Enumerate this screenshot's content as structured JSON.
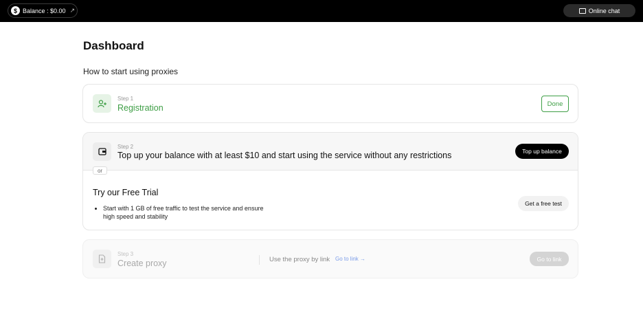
{
  "topbar": {
    "balance_label": "Balance : $0.00",
    "balance_icon": "$",
    "balance_arrow": "↗",
    "chat_label": "Online chat",
    "chat_icon": "message-square-icon"
  },
  "page": {
    "title": "Dashboard",
    "subtitle": "How to start using proxies"
  },
  "steps": [
    {
      "step_label": "Step 1",
      "title": "Registration",
      "icon": "user-add-icon",
      "button": "Done",
      "status_color": "#3e9e45"
    },
    {
      "step_label": "Step 2",
      "title": "Top up your balance with at least $10 and start using the service without any restrictions",
      "icon": "wallet-icon",
      "button": "Top up balance",
      "or_label": "or",
      "trial": {
        "title": "Try our Free Trial",
        "bullets": [
          "Start with 1 GB of free traffic to test the service and ensure high speed and stability"
        ],
        "button": "Get a free test"
      }
    },
    {
      "step_label": "Step 3",
      "title": "Create proxy",
      "icon": "document-plus-icon",
      "proxy_text": "Use the proxy by link",
      "link_text": "Go to link →",
      "button": "Go to link"
    }
  ]
}
